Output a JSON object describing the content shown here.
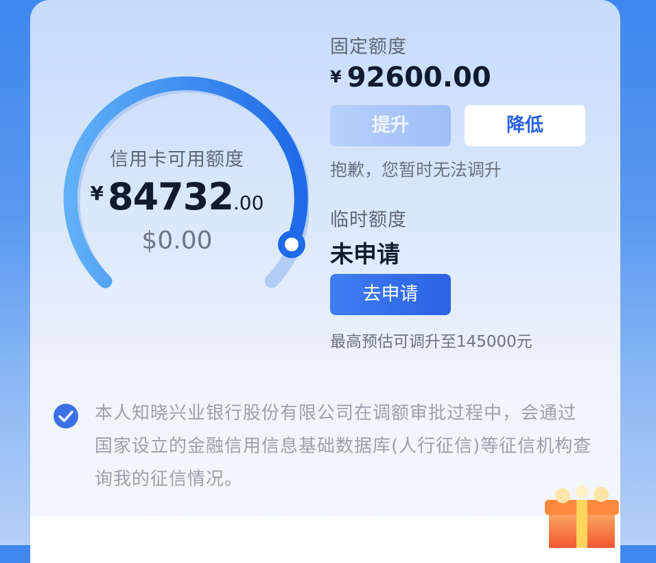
{
  "credit_card": {
    "label": "信用卡可用额度",
    "currency": "¥",
    "amount_int": "84732",
    "amount_dec": ".00",
    "usd": "$0.00",
    "usage_fraction": 1.0
  },
  "fixed_limit": {
    "label": "固定额度",
    "currency": "¥",
    "amount": "92600.00",
    "raise_label": "提升",
    "lower_label": "降低",
    "hint": "抱歉，您暂时无法调升"
  },
  "temporary_limit": {
    "label": "临时额度",
    "status": "未申请",
    "apply_label": "去申请",
    "estimate": "最高预估可调升至145000元"
  },
  "consent": {
    "checked": true,
    "text": "本人知晓兴业银行股份有限公司在调额审批过程中，会通过国家设立的金融信用信息基础数据库(人行征信)等征信机构查询我的征信情况。"
  },
  "colors": {
    "accent": "#2b63e3",
    "gauge_start": "#5fb0f7",
    "gauge_end": "#1f6ae8",
    "text_dark": "#111a2e"
  }
}
